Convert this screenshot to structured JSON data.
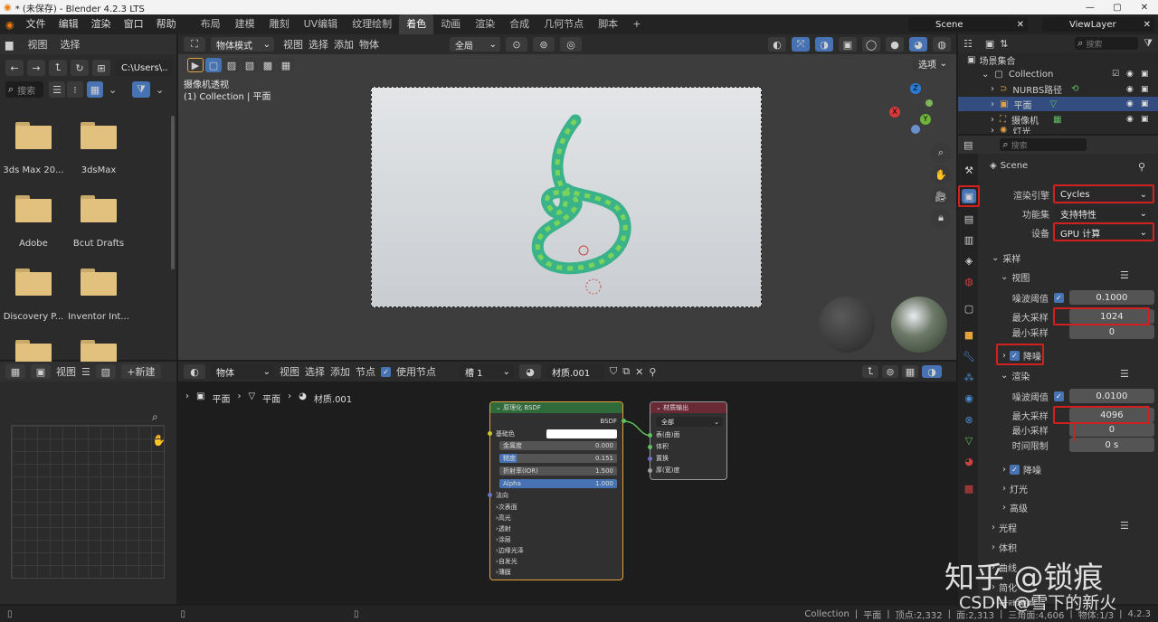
{
  "window": {
    "title": "* (未保存) - Blender 4.2.3 LTS"
  },
  "menu": [
    "文件",
    "编辑",
    "渲染",
    "窗口",
    "帮助"
  ],
  "workspaces": [
    "布局",
    "建模",
    "雕刻",
    "UV编辑",
    "纹理绘制",
    "着色",
    "动画",
    "渲染",
    "合成",
    "几何节点",
    "脚本"
  ],
  "workspace_active": "着色",
  "scene": {
    "name": "Scene",
    "view_layer": "ViewLayer"
  },
  "filebrowser": {
    "menus": [
      "视图",
      "选择"
    ],
    "path": "C:\\Users\\...",
    "search_placeholder": "搜索",
    "items": [
      {
        "name": "3ds Max 20..."
      },
      {
        "name": "3dsMax"
      },
      {
        "name": "Adobe"
      },
      {
        "name": "Bcut Drafts"
      },
      {
        "name": "Discovery P..."
      },
      {
        "name": "Inventor Int..."
      },
      {
        "name": ""
      },
      {
        "name": ""
      }
    ]
  },
  "viewport": {
    "mode": "物体模式",
    "menus": [
      "视图",
      "选择",
      "添加",
      "物体"
    ],
    "transform": "全局",
    "options": "选项",
    "info_line1": "摄像机透视",
    "info_line2": "(1) Collection | 平面",
    "gizmo": {
      "z": "Z",
      "x": "X",
      "y": "Y"
    }
  },
  "image_editor": {
    "view": "视图",
    "new_button": "新建"
  },
  "node_editor": {
    "type": "物体",
    "menus": [
      "视图",
      "选择",
      "添加",
      "节点"
    ],
    "use_nodes": "使用节点",
    "slot": "槽 1",
    "material": "材质.001",
    "breadcrumb": [
      "平面",
      "平面",
      "材质.001"
    ],
    "bsdf": {
      "title": "原理化 BSDF",
      "output": "BSDF",
      "base_color": "基础色",
      "metallic_label": "金属度",
      "metallic": "0.000",
      "roughness_label": "糙度",
      "roughness": "0.151",
      "ior_label": "折射率(IOR)",
      "ior": "1.500",
      "alpha_label": "Alpha",
      "alpha": "1.000",
      "normal": "法向",
      "subs": [
        "次表面",
        "高光",
        "透射",
        "涂层",
        "边缘光泽",
        "自发光",
        "薄膜"
      ]
    },
    "output": {
      "title": "材质输出",
      "target": "全部",
      "sockets": [
        "表(曲)面",
        "体积",
        "置换",
        "厚(宽)度"
      ]
    }
  },
  "outliner": {
    "search_placeholder": "搜索",
    "root": "场景集合",
    "collection": "Collection",
    "items": [
      "NURBS路径",
      "平面",
      "摄像机",
      "灯光"
    ]
  },
  "properties": {
    "search_placeholder": "搜索",
    "scene": "Scene",
    "render_engine_label": "渲染引擎",
    "render_engine": "Cycles",
    "feature_set_label": "功能集",
    "feature_set": "支持特性",
    "device_label": "设备",
    "device": "GPU 计算",
    "sampling": "采样",
    "viewport": "视图",
    "noise_threshold_label": "噪波阈值",
    "vp_noise_threshold": "0.1000",
    "max_samples_label": "最大采样",
    "vp_max_samples": "1024",
    "min_samples_label": "最小采样",
    "vp_min_samples": "0",
    "denoise": "降噪",
    "render": "渲染",
    "r_noise_threshold": "0.0100",
    "r_max_samples": "4096",
    "r_min_samples": "0",
    "time_limit_label": "时间限制",
    "time_limit": "0 s",
    "r_denoise": "降噪",
    "lights": "灯光",
    "advanced": "高级",
    "light_paths": "光程",
    "volumes": "体积",
    "curves": "曲线",
    "simplify": "简化",
    "motion_blur": "运动模糊"
  },
  "statusbar": {
    "collection": "Collection",
    "object": "平面",
    "verts": "顶点:2,332",
    "faces": "面:2,313",
    "tris": "三角面:4,606",
    "objects": "物体:1/3",
    "version": "4.2.3"
  },
  "watermark": {
    "line1": "知乎 @锁痕",
    "line2": "CSDN @雪下的新火"
  },
  "colors": {
    "accent": "#4772b3",
    "highlight": "#d02020",
    "folder": "#e2c17f"
  }
}
